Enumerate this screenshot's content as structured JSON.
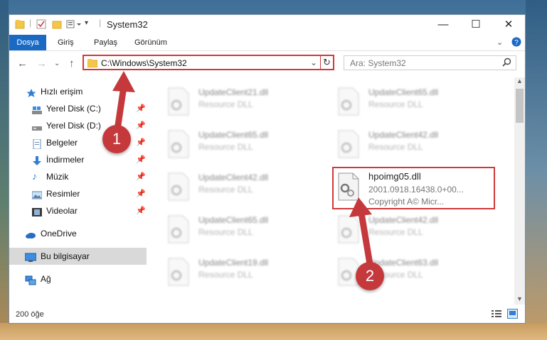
{
  "window": {
    "title": "System32"
  },
  "ribbon": {
    "tabs": [
      "Dosya",
      "Giriş",
      "Paylaş",
      "Görünüm"
    ]
  },
  "address": {
    "path": "C:\\Windows\\System32"
  },
  "search": {
    "placeholder": "Ara: System32"
  },
  "sidebar": {
    "items": [
      {
        "label": "Hızlı erişim"
      },
      {
        "label": "Yerel Disk (C:)"
      },
      {
        "label": "Yerel Disk (D:)"
      },
      {
        "label": "Belgeler"
      },
      {
        "label": "İndirmeler"
      },
      {
        "label": "Müzik"
      },
      {
        "label": "Resimler"
      },
      {
        "label": "Videolar"
      },
      {
        "label": "OneDrive"
      },
      {
        "label": "Bu bilgisayar"
      },
      {
        "label": "Ağ"
      }
    ]
  },
  "files": [
    {
      "name": "UpdateClient21.dll",
      "type": "Resource DLL"
    },
    {
      "name": "UpdateClient65.dll",
      "type": "Resource DLL"
    },
    {
      "name": "UpdateClient65.dll",
      "type": "Resource DLL"
    },
    {
      "name": "UpdateClient42.dll",
      "type": "Resource DLL"
    },
    {
      "name": "UpdateClient42.dll",
      "type": "Resource DLL"
    },
    {
      "name": "hpoimg05.dll",
      "version": "2001.0918.16438.0+00...",
      "copyright": "Copyright A© Micr..."
    },
    {
      "name": "UpdateClient65.dll",
      "type": "Resource DLL"
    },
    {
      "name": "UpdateClient42.dll",
      "type": "Resource DLL"
    },
    {
      "name": "UpdateClient19.dll",
      "type": "Resource DLL"
    },
    {
      "name": "UpdateClient63.dll",
      "type": "Resource DLL"
    }
  ],
  "status": {
    "count": "200 öğe"
  },
  "annotations": {
    "step1": "1",
    "step2": "2"
  },
  "colors": {
    "accent": "#1a6ac4",
    "highlight": "#d0393a",
    "annotation": "#c5393c"
  }
}
